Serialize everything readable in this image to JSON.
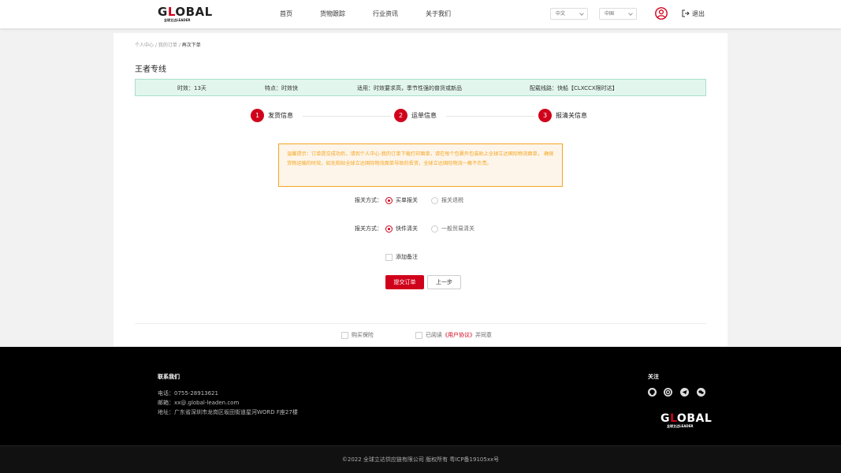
{
  "header": {
    "logo_text": "GLOBAL",
    "logo_sub": "全球立达LEADER",
    "nav": [
      "首页",
      "货物跟踪",
      "行业资讯",
      "关于我们"
    ],
    "language_select": "中文",
    "country_select": "中国",
    "logout_label": "退出"
  },
  "breadcrumb": {
    "items": [
      "个人中心",
      "我的订单",
      "再次下单"
    ],
    "separator": "/"
  },
  "page_title": "王者专线",
  "info_bar": {
    "timing": "时效：13天",
    "feature": "特点：时效快",
    "applicable": "适用：时效要求高，季节性强的普货或新品",
    "route": "配载线路：快船【CLXCCX限时达】"
  },
  "steps": [
    {
      "num": "1",
      "label": "发货信息"
    },
    {
      "num": "2",
      "label": "运单信息"
    },
    {
      "num": "3",
      "label": "报清关信息"
    }
  ],
  "notice": "温馨提示：订单提交成功后，请到个人中心-我的订单下载打印面单，请在每个包裹外包装贴上全球立达国际物流面单， 确保货物运输的时效，如无粘贴全球立达国际物流面单导致的丢货，全球立达国际物流一概不负责。",
  "form": {
    "declare_label": "报关方式：",
    "declare_options": [
      "买单报关",
      "报关退税"
    ],
    "declare_selected": 0,
    "clearance_label": "报关方式：",
    "clearance_options": [
      "快件清关",
      "一般贸易清关"
    ],
    "clearance_selected": 0,
    "remark_label": "添加备注",
    "submit_label": "提交订单",
    "prev_label": "上一步"
  },
  "agreements": {
    "insurance": "购买保险",
    "read_prefix": "已阅读",
    "user_agreement": "《用户协议》",
    "read_suffix": "并同意"
  },
  "footer": {
    "contact_title": "联系我们",
    "phone": "电话：0755-28913621",
    "email": "邮箱：xx@.global-leaden.com",
    "address": "地址：广东省深圳市龙岗区坂田街道星河WORD F座27楼",
    "follow_title": "关注",
    "social_icons": [
      "github-icon",
      "chrome-icon",
      "telegram-icon",
      "chat-icon"
    ],
    "copyright": "©2022 全球立达供应链有限公司 版权所有 粤ICP备19105xx号"
  },
  "colors": {
    "brand_red": "#d0021b",
    "info_bg": "#e2f6ee",
    "notice_orange": "#f5a623"
  }
}
